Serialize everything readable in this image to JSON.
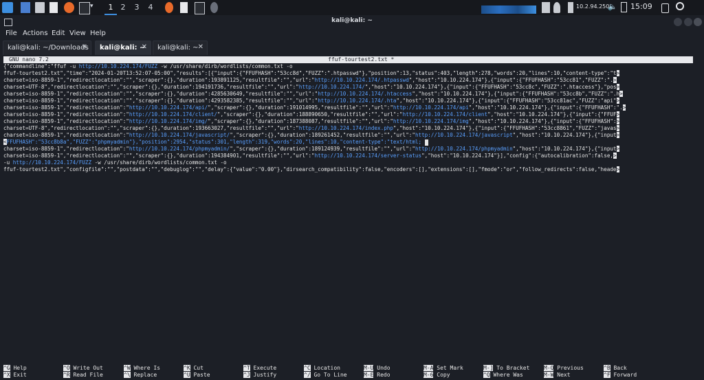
{
  "panel": {
    "workspaces": [
      "1",
      "2",
      "3",
      "4"
    ],
    "ip": "10.2.94.250",
    "clock": "15:09"
  },
  "window": {
    "title": "kali@kali: ~",
    "menu": [
      "File",
      "Actions",
      "Edit",
      "View",
      "Help"
    ],
    "tabs": [
      {
        "label": "kali@kali: ~/Downloads",
        "active": false
      },
      {
        "label": "kali@kali: ~",
        "active": true
      },
      {
        "label": "kali@kali: ~",
        "active": false
      }
    ]
  },
  "nano": {
    "version": "GNU nano 7.2",
    "filename": "ffuf-tourtest2.txt *"
  },
  "content_lines": [
    [
      {
        "t": "{\"commandline\":\"ffuf -u "
      },
      {
        "t": "http://10.10.224.174/FUZZ",
        "u": 1
      },
      {
        "t": " -w /usr/share/dirb/wordlists/common.txt -o"
      }
    ],
    [
      {
        "t": "ffuf-tourtest2.txt\",\"time\":\"2024-01-20T13:52:07-05:00\",\"results\":[{\"input\":{\"FFUFHASH\":\"53cc8d\",\"FUZZ\":\".htpasswd\"},\"position\":13,\"status\":403,\"length\":278,\"words\":20,\"lines\":10,\"content-type\":\"t"
      },
      {
        "t": ">",
        "a": 1
      }
    ],
    [
      {
        "t": "charset=iso-8859-1\",\"redirectlocation\":\"\",\"scraper\":{},\"duration\":193891125,\"resultfile\":\"\",\"url\":\""
      },
      {
        "t": "http://10.10.224.174/.htpasswd",
        "u": 1
      },
      {
        "t": "\",\"host\":\"10.10.224.174\"},{\"input\":{\"FFUFHASH\":\"53cc81\",\"FUZZ\":\"."
      },
      {
        "t": ">",
        "a": 1
      }
    ],
    [
      {
        "t": "charset=UTF-8\",\"redirectlocation\":\"\",\"scraper\":{},\"duration\":194191736,\"resultfile\":\"\",\"url\":\""
      },
      {
        "t": "http://10.10.224.174/",
        "u": 1
      },
      {
        "t": "\",\"host\":\"10.10.224.174\"},{\"input\":{\"FFUFHASH\":\"53cc8c\",\"FUZZ\":\".htaccess\"},\"pos"
      },
      {
        "t": ">",
        "a": 1
      }
    ],
    [
      {
        "t": "charset=iso-8859-1\",\"redirectlocation\":\"\",\"scraper\":{},\"duration\":4285630649,\"resultfile\":\"\",\"url\":\""
      },
      {
        "t": "http://10.10.224.174/.htaccess",
        "u": 1
      },
      {
        "t": "\",\"host\":\"10.10.224.174\"},{\"input\":{\"FFUFHASH\":\"53cc8b\",\"FUZZ\":\".h"
      },
      {
        "t": ">",
        "a": 1
      }
    ],
    [
      {
        "t": "charset=iso-8859-1\",\"redirectlocation\":\"\",\"scraper\":{},\"duration\":4293582385,\"resultfile\":\"\",\"url\":\""
      },
      {
        "t": "http://10.10.224.174/.hta",
        "u": 1
      },
      {
        "t": "\",\"host\":\"10.10.224.174\"},{\"input\":{\"FFUFHASH\":\"53cc81ac\",\"FUZZ\":\"api\""
      },
      {
        "t": ">",
        "a": 1
      }
    ],
    [
      {
        "t": "charset=iso-8859-1\",\"redirectlocation\":\""
      },
      {
        "t": "http://10.10.224.174/api/",
        "u": 1
      },
      {
        "t": "\",\"scraper\":{},\"duration\":191014995,\"resultfile\":\"\",\"url\":\""
      },
      {
        "t": "http://10.10.224.174/api",
        "u": 1
      },
      {
        "t": "\",\"host\":\"10.10.224.174\"},{\"input\":{\"FFUFHASH\":\"."
      },
      {
        "t": ">",
        "a": 1
      }
    ],
    [
      {
        "t": "charset=iso-8859-1\",\"redirectlocation\":\""
      },
      {
        "t": "http://10.10.224.174/client/",
        "u": 1
      },
      {
        "t": "\",\"scraper\":{},\"duration\":188890650,\"resultfile\":\"\",\"url\":\""
      },
      {
        "t": "http://10.10.224.174/client",
        "u": 1
      },
      {
        "t": "\",\"host\":\"10.10.224.174\"},{\"input\":{\"FFUF"
      },
      {
        "t": ">",
        "a": 1
      }
    ],
    [
      {
        "t": "charset=iso-8859-1\",\"redirectlocation\":\""
      },
      {
        "t": "http://10.10.224.174/img/",
        "u": 1
      },
      {
        "t": "\",\"scraper\":{},\"duration\":187388087,\"resultfile\":\"\",\"url\":\""
      },
      {
        "t": "http://10.10.224.174/img",
        "u": 1
      },
      {
        "t": "\",\"host\":\"10.10.224.174\"},{\"input\":{\"FFUFHASH\":"
      },
      {
        "t": ">",
        "a": 1
      }
    ],
    [
      {
        "t": "charset=UTF-8\",\"redirectlocation\":\"\",\"scraper\":{},\"duration\":193663027,\"resultfile\":\"\",\"url\":\""
      },
      {
        "t": "http://10.10.224.174/index.php",
        "u": 1
      },
      {
        "t": "\",\"host\":\"10.10.224.174\"},{\"input\":{\"FFUFHASH\":\"53cc8861\",\"FUZZ\":\"javas"
      },
      {
        "t": ">",
        "a": 1
      }
    ],
    [
      {
        "t": "charset=iso-8859-1\",\"redirectlocation\":\""
      },
      {
        "t": "http://10.10.224.174/javascript/",
        "u": 1
      },
      {
        "t": "\",\"scraper\":{},\"duration\":189261452,\"resultfile\":\"\",\"url\":\""
      },
      {
        "t": "http://10.10.224.174/javascript",
        "u": 1
      },
      {
        "t": "\",\"host\":\"10.10.224.174\"},{\"input"
      },
      {
        "t": ">",
        "a": 1
      }
    ],
    [
      {
        "t": "<",
        "a": 1
      },
      {
        "t": "FFUFHASH\":\"53cc8b8a\",\"FUZZ\":\"phpmyadmin\"},\"position\":2954,\"status\":301,\"length\":319,\"words\":20,\"lines\":10,\"content-type\":\"text/html;",
        "u": 1
      },
      {
        "t": " "
      },
      {
        "t": "█",
        "c": 1
      }
    ],
    [
      {
        "t": "charset=iso-8859-1\",\"redirectlocation\":\""
      },
      {
        "t": "http://10.10.224.174/phpmyadmin/",
        "u": 1
      },
      {
        "t": "\",\"scraper\":{},\"duration\":189124939,\"resultfile\":\"\",\"url\":\""
      },
      {
        "t": "http://10.10.224.174/phpmyadmin",
        "u": 1
      },
      {
        "t": "\",\"host\":\"10.10.224.174\"},{\"input"
      },
      {
        "t": ">",
        "a": 1
      }
    ],
    [
      {
        "t": "charset=iso-8859-1\",\"redirectlocation\":\"\",\"scraper\":{},\"duration\":194384901,\"resultfile\":\"\",\"url\":\""
      },
      {
        "t": "http://10.10.224.174/server-status",
        "u": 1
      },
      {
        "t": "\",\"host\":\"10.10.224.174\"}],\"config\":{\"autocalibration\":false,"
      },
      {
        "t": ">",
        "a": 1
      }
    ],
    [
      {
        "t": "-u "
      },
      {
        "t": "http://10.10.224.174/FUZZ",
        "u": 1
      },
      {
        "t": " -w /usr/share/dirb/wordlists/common.txt -o"
      }
    ],
    [
      {
        "t": "ffuf-tourtest2.txt\",\"configfile\":\"\",\"postdata\":\"\",\"debuglog\":\"\",\"delay\":{\"value\":\"0.00\"},\"dirsearch_compatibility\":false,\"encoders\":[],\"extensions\":[],\"fmode\":\"or\",\"follow_redirects\":false,\"heade"
      },
      {
        "t": ">",
        "a": 1
      }
    ]
  ],
  "shortcuts": [
    {
      "key": "^G",
      "desc": "Help"
    },
    {
      "key": "^X",
      "desc": "Exit"
    },
    {
      "key": "^O",
      "desc": "Write Out"
    },
    {
      "key": "^R",
      "desc": "Read File"
    },
    {
      "key": "^W",
      "desc": "Where Is"
    },
    {
      "key": "^\\",
      "desc": "Replace"
    },
    {
      "key": "^K",
      "desc": "Cut"
    },
    {
      "key": "^U",
      "desc": "Paste"
    },
    {
      "key": "^T",
      "desc": "Execute"
    },
    {
      "key": "^J",
      "desc": "Justify"
    },
    {
      "key": "^C",
      "desc": "Location"
    },
    {
      "key": "^/",
      "desc": "Go To Line"
    },
    {
      "key": "M-U",
      "desc": "Undo"
    },
    {
      "key": "M-E",
      "desc": "Redo"
    },
    {
      "key": "M-A",
      "desc": "Set Mark"
    },
    {
      "key": "M-6",
      "desc": "Copy"
    },
    {
      "key": "M-]",
      "desc": "To Bracket"
    },
    {
      "key": "^Q",
      "desc": "Where Was"
    },
    {
      "key": "M-Q",
      "desc": "Previous"
    },
    {
      "key": "M-W",
      "desc": "Next"
    },
    {
      "key": "^B",
      "desc": "Back"
    },
    {
      "key": "^F",
      "desc": "Forward"
    }
  ]
}
